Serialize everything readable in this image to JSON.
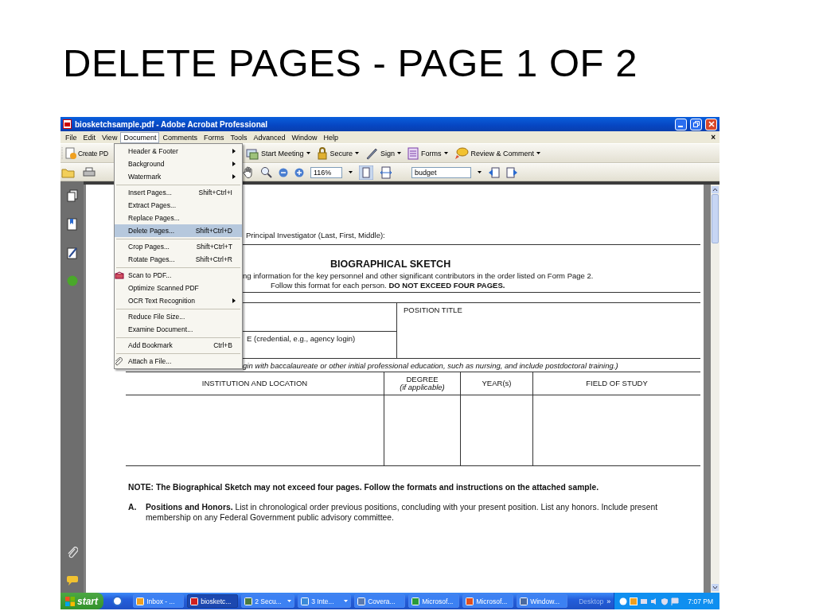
{
  "slide_title": "DELETE PAGES - PAGE 1 OF 2",
  "window": {
    "title": "biosketchsample.pdf - Adobe Acrobat Professional"
  },
  "menu_bar": {
    "close": "×",
    "items": [
      {
        "label": "File",
        "selected": false
      },
      {
        "label": "Edit",
        "selected": false
      },
      {
        "label": "View",
        "selected": false
      },
      {
        "label": "Document",
        "selected": true
      },
      {
        "label": "Comments",
        "selected": false
      },
      {
        "label": "Forms",
        "selected": false
      },
      {
        "label": "Tools",
        "selected": false
      },
      {
        "label": "Advanced",
        "selected": false
      },
      {
        "label": "Window",
        "selected": false
      },
      {
        "label": "Help",
        "selected": false
      }
    ]
  },
  "toolbar": [
    {
      "label": "Create PD",
      "dropdown": false
    },
    {
      "label": "Start Meeting",
      "dropdown": true
    },
    {
      "label": "Secure",
      "dropdown": true
    },
    {
      "label": "Sign",
      "dropdown": true
    },
    {
      "label": "Forms",
      "dropdown": true
    },
    {
      "label": "Review & Comment",
      "dropdown": true
    }
  ],
  "nav_toolbar": {
    "zoom": "116%",
    "search": "budget"
  },
  "document_menu": [
    [
      {
        "label": "Header & Footer",
        "submenu": true,
        "selected": false
      },
      {
        "label": "Background",
        "submenu": true,
        "selected": false
      },
      {
        "label": "Watermark",
        "submenu": true,
        "selected": false
      }
    ],
    [
      {
        "label": "Insert Pages...",
        "shortcut": "Shift+Ctrl+I",
        "submenu": false,
        "selected": false
      },
      {
        "label": "Extract Pages...",
        "submenu": false,
        "selected": false
      },
      {
        "label": "Replace Pages...",
        "submenu": false,
        "selected": false
      },
      {
        "label": "Delete Pages...",
        "shortcut": "Shift+Ctrl+D",
        "submenu": false,
        "selected": true
      }
    ],
    [
      {
        "label": "Crop Pages...",
        "shortcut": "Shift+Ctrl+T",
        "submenu": false,
        "selected": false
      },
      {
        "label": "Rotate Pages...",
        "shortcut": "Shift+Ctrl+R",
        "submenu": false,
        "selected": false
      }
    ],
    [
      {
        "label": "Scan to PDF...",
        "submenu": false,
        "selected": false
      },
      {
        "label": "Optimize Scanned PDF",
        "submenu": false,
        "selected": false
      },
      {
        "label": "OCR Text Recognition",
        "submenu": true,
        "selected": false
      }
    ],
    [
      {
        "label": "Reduce File Size...",
        "submenu": false,
        "selected": false
      },
      {
        "label": "Examine Document...",
        "submenu": false,
        "selected": false
      }
    ],
    [
      {
        "label": "Add Bookmark",
        "shortcut": "Ctrl+B",
        "submenu": false,
        "selected": false
      }
    ],
    [
      {
        "label": "Attach a File...",
        "submenu": false,
        "selected": false
      }
    ]
  ],
  "document": {
    "principal_label": "Principal Investigator (Last, First, Middle):",
    "heading": "BIOGRAPHICAL SKETCH",
    "instructions": "ng information for the key personnel and other significant contributors in the order listed on Form Page 2.",
    "format_note": "Follow this format for each person.  **DO NOT EXCEED FOUR PAGES.**",
    "credential_label": "E (credential, e.g., agency login)",
    "position_title": "POSITION TITLE",
    "education_note": "gin with baccalaureate or other initial professional education, such as nursing, and include postdoctoral training.)",
    "education_columns": [
      {
        "label": "INSTITUTION AND LOCATION"
      },
      {
        "label": "DEGREE",
        "sublabel": "(if applicable)"
      },
      {
        "label": "YEAR(s)"
      },
      {
        "label": "FIELD OF STUDY"
      }
    ],
    "note": "NOTE: The Biographical Sketch may not exceed four pages. Follow the formats and instructions on the attached sample.",
    "sections": [
      {
        "marker": "A.",
        "text": "**Positions and Honors.** List in chronological order previous positions, concluding with your present position. List any honors. Include present membership on any Federal Government public advisory committee."
      }
    ]
  },
  "taskbar": {
    "start": "start",
    "desktop": "Desktop",
    "more": "»",
    "clock": "7:07 PM",
    "items": [
      {
        "label": "Inbox - ...",
        "selected": false,
        "dropdown": false
      },
      {
        "label": "biosketc...",
        "selected": true,
        "dropdown": false
      },
      {
        "label": "2 Secu...",
        "selected": false,
        "dropdown": true
      },
      {
        "label": "3 Inte...",
        "selected": false,
        "dropdown": true
      },
      {
        "label": "Covera...",
        "selected": false,
        "dropdown": false
      },
      {
        "label": "Microsof...",
        "selected": false,
        "dropdown": false
      },
      {
        "label": "Microsof...",
        "selected": false,
        "dropdown": false
      },
      {
        "label": "Window...",
        "selected": false,
        "dropdown": false
      }
    ]
  }
}
